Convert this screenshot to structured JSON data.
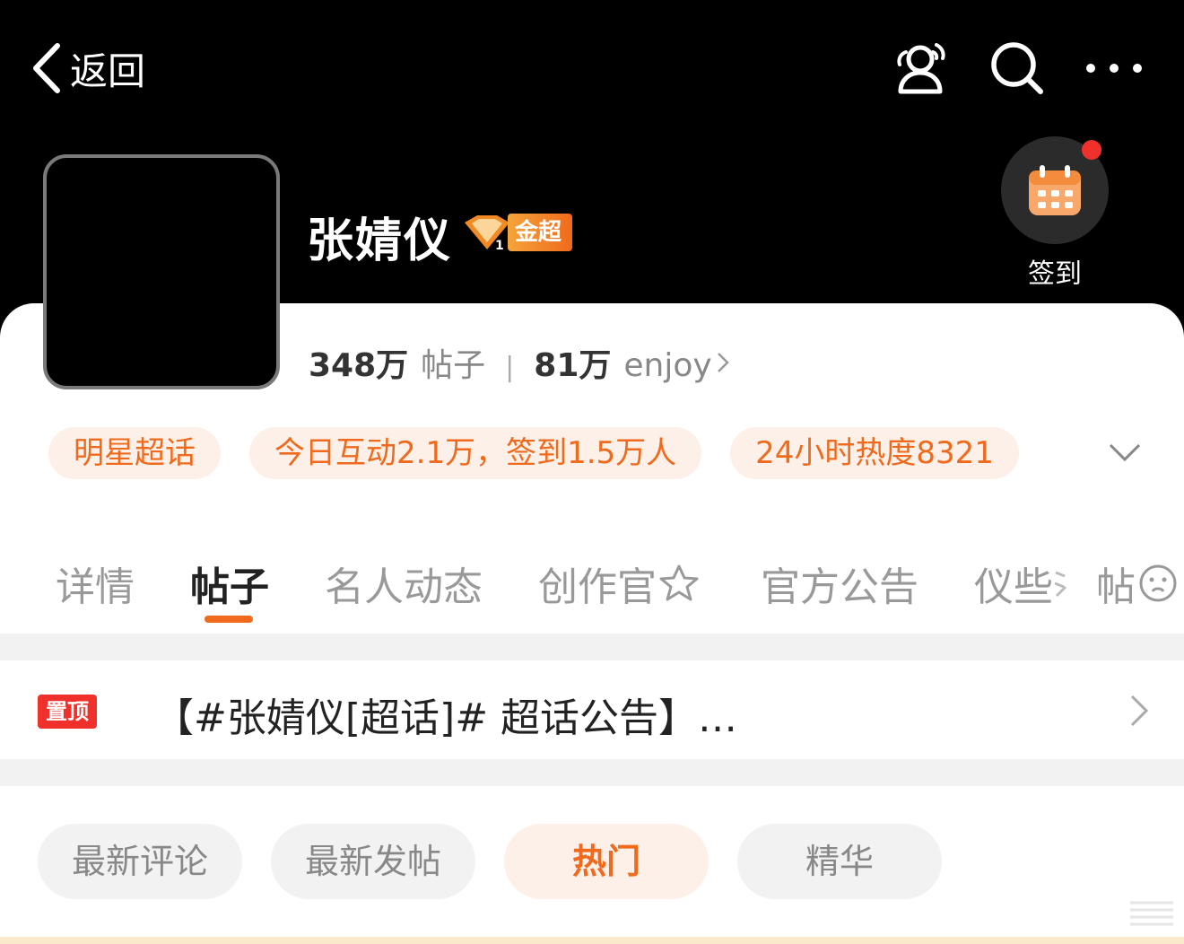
{
  "header": {
    "back_label": "返回"
  },
  "profile": {
    "name": "张婧仪",
    "badge_label": "金超",
    "signin_label": "签到",
    "stats": {
      "posts_num": "348万",
      "posts_unit": "帖子",
      "fans_num": "81万",
      "fans_unit": "enjoy"
    }
  },
  "tags": [
    "明星超话",
    "今日互动2.1万，签到1.5万人",
    "24小时热度8321"
  ],
  "tabs": [
    {
      "label": "详情"
    },
    {
      "label": "帖子"
    },
    {
      "label": "名人动态"
    },
    {
      "label": "创作官"
    },
    {
      "label": "官方公告"
    },
    {
      "label": "仪些"
    },
    {
      "label": "帖"
    }
  ],
  "pinned": {
    "badge": "置顶",
    "text": "【#张婧仪[超话]# 超话公告】…"
  },
  "filters": [
    {
      "label": "最新评论"
    },
    {
      "label": "最新发帖"
    },
    {
      "label": "热门"
    },
    {
      "label": "精华"
    }
  ],
  "colors": {
    "accent": "#ef6a1c",
    "pin_red": "#f0302a",
    "tag_bg": "#fdf0e8"
  }
}
